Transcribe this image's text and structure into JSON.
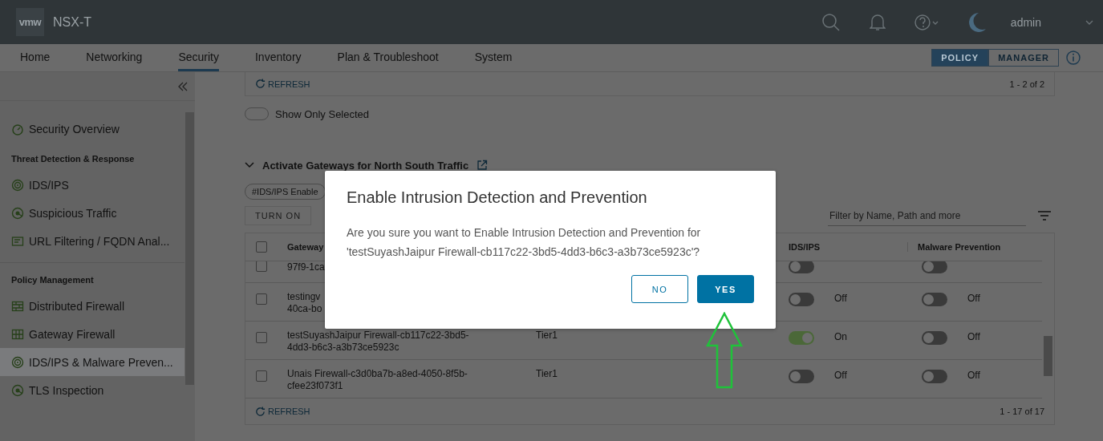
{
  "header": {
    "logo": "vmw",
    "product": "NSX-T",
    "user": "admin"
  },
  "nav_tabs": [
    {
      "label": "Home",
      "selected": false
    },
    {
      "label": "Networking",
      "selected": false
    },
    {
      "label": "Security",
      "selected": true
    },
    {
      "label": "Inventory",
      "selected": false
    },
    {
      "label": "Plan & Troubleshoot",
      "selected": false
    },
    {
      "label": "System",
      "selected": false
    }
  ],
  "mode_switch": [
    {
      "label": "POLICY",
      "selected": true
    },
    {
      "label": "MANAGER",
      "selected": false
    }
  ],
  "sidebar": {
    "items": [
      {
        "kind": "item",
        "label": "Security Overview",
        "selected": false
      },
      {
        "kind": "heading",
        "label": "Threat Detection & Response"
      },
      {
        "kind": "item",
        "label": "IDS/IPS",
        "selected": false
      },
      {
        "kind": "item",
        "label": "Suspicious Traffic",
        "selected": false
      },
      {
        "kind": "item",
        "label": "URL Filtering / FQDN Anal...",
        "selected": false
      },
      {
        "kind": "divider"
      },
      {
        "kind": "heading",
        "label": "Policy Management"
      },
      {
        "kind": "item",
        "label": "Distributed Firewall",
        "selected": false
      },
      {
        "kind": "item",
        "label": "Gateway Firewall",
        "selected": false
      },
      {
        "kind": "item",
        "label": "IDS/IPS & Malware Preven...",
        "selected": true
      },
      {
        "kind": "item",
        "label": "TLS Inspection",
        "selected": false
      }
    ]
  },
  "top_panel": {
    "refresh": "REFRESH",
    "count": "1 - 2 of 2"
  },
  "show_only_selected": {
    "label": "Show Only Selected",
    "on": false
  },
  "section": {
    "title": "Activate Gateways for North South Traffic",
    "expanded": true,
    "chip": "#IDS/IPS Enable",
    "turn_on": "TURN ON",
    "filter_placeholder": "Filter by Name, Path and more"
  },
  "table": {
    "columns": [
      "Gateway",
      "IDS/IPS",
      "Malware Prevention"
    ],
    "all_checked": false,
    "rows": [
      {
        "kind": "partial",
        "checked": false,
        "name": [
          "97f9-1ca"
        ],
        "ids_on": false,
        "malware_on": false
      },
      {
        "kind": "full",
        "checked": false,
        "name": [
          "testingv",
          "40ca-bo"
        ],
        "ids_on": false,
        "ids_label": "Off",
        "malware_on": false,
        "malware_label": "Off"
      },
      {
        "kind": "full",
        "checked": false,
        "name": [
          "testSuyashJaipur Firewall-cb117c22-3bd5-",
          "4dd3-b6c3-a3b73ce5923c"
        ],
        "type": "Tier1",
        "ids_on": true,
        "ids_label": "On",
        "malware_on": false,
        "malware_label": "Off"
      },
      {
        "kind": "full",
        "checked": false,
        "name": [
          "Unais Firewall-c3d0ba7b-a8ed-4050-8f5b-",
          "cfee23f073f1"
        ],
        "type": "Tier1",
        "ids_on": false,
        "ids_label": "Off",
        "malware_on": false,
        "malware_label": "Off"
      }
    ],
    "refresh": "REFRESH",
    "count": "1 - 17 of 17"
  },
  "dialog": {
    "title": "Enable Intrusion Detection and Prevention",
    "message": "Are you sure you want to Enable Intrusion Detection and Prevention for 'testSuyashJaipur Firewall-cb117c22-3bd5-4dd3-b6c3-a3b73ce5923c'?",
    "buttons": [
      {
        "label": "NO",
        "kind": "secondary"
      },
      {
        "label": "YES",
        "kind": "primary"
      }
    ]
  }
}
